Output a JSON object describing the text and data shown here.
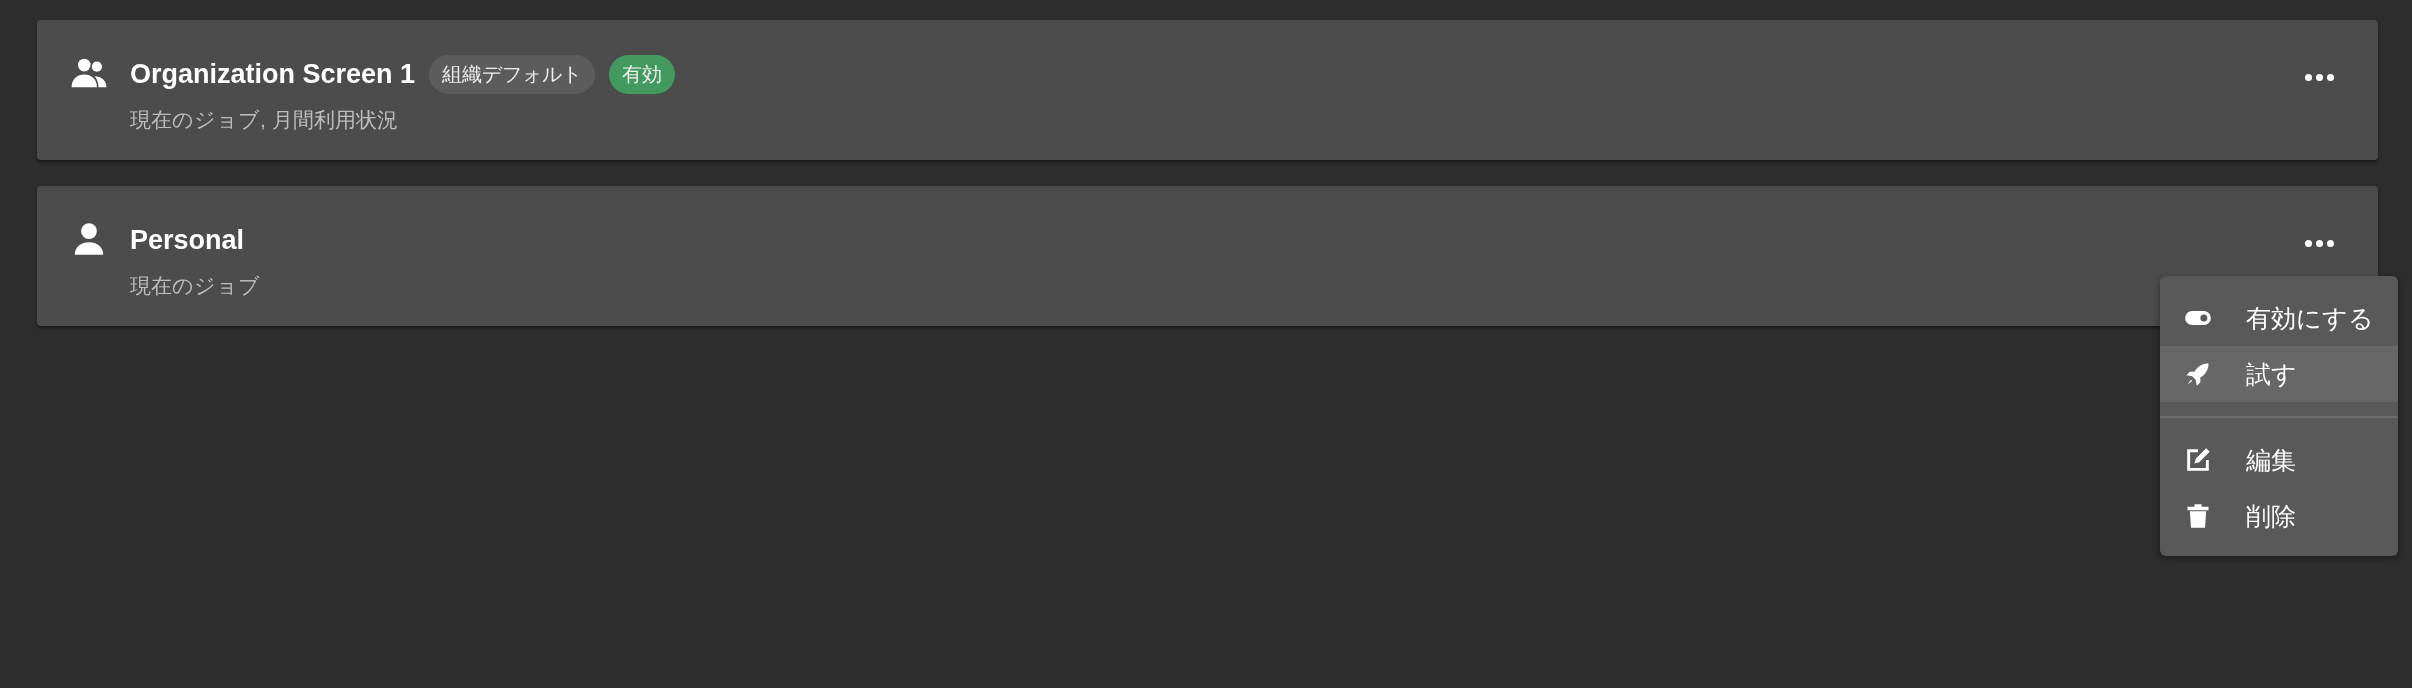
{
  "cards": [
    {
      "kind": "group",
      "title": "Organization Screen 1",
      "badges": [
        {
          "label": "組織デフォルト",
          "color": "#5c5c5c"
        },
        {
          "label": "有効",
          "color": "#439a5f"
        }
      ],
      "subtitle": "現在のジョブ, 月間利用状況"
    },
    {
      "kind": "person",
      "title": "Personal",
      "subtitle": "現在のジョブ"
    }
  ],
  "menu": {
    "groups": [
      [
        {
          "kind": "toggle",
          "label": "有効にする",
          "selected": false
        },
        {
          "kind": "rocket",
          "label": "試す",
          "selected": true
        }
      ],
      [
        {
          "kind": "edit",
          "label": "編集",
          "selected": false
        },
        {
          "kind": "trash",
          "label": "削除",
          "selected": false
        }
      ]
    ]
  }
}
